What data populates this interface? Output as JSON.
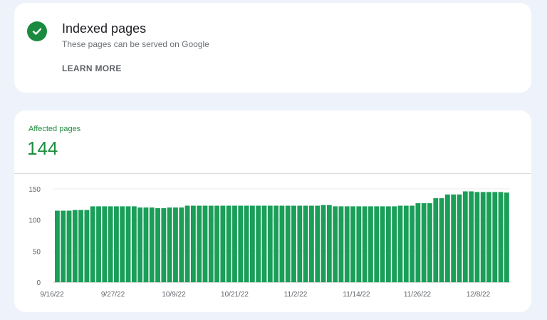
{
  "status": {
    "title": "Indexed pages",
    "subtitle": "These pages can be served on Google",
    "learn_more": "LEARN MORE",
    "icon": "check-circle-icon",
    "color": "#1a8a3e"
  },
  "metric": {
    "label": "Affected pages",
    "value": "144",
    "color": "#1e8e3e"
  },
  "chart_data": {
    "type": "bar",
    "color": "#1a9e58",
    "grid": true,
    "ylim": [
      0,
      150
    ],
    "yticks": [
      0,
      50,
      100,
      150
    ],
    "xtick_labels": [
      "9/16/22",
      "9/27/22",
      "10/9/22",
      "10/21/22",
      "11/2/22",
      "11/14/22",
      "11/26/22",
      "12/8/22"
    ],
    "values": [
      115,
      115,
      115,
      116,
      116,
      116,
      122,
      122,
      122,
      122,
      122,
      122,
      122,
      122,
      120,
      120,
      120,
      119,
      119,
      120,
      120,
      120,
      123,
      123,
      123,
      123,
      123,
      123,
      123,
      123,
      123,
      123,
      123,
      123,
      123,
      123,
      123,
      123,
      123,
      123,
      123,
      123,
      123,
      123,
      123,
      124,
      124,
      122,
      122,
      122,
      122,
      122,
      122,
      122,
      122,
      122,
      122,
      122,
      123,
      123,
      123,
      127,
      127,
      127,
      135,
      135,
      141,
      141,
      141,
      146,
      146,
      145,
      145,
      145,
      145,
      145,
      144
    ]
  }
}
